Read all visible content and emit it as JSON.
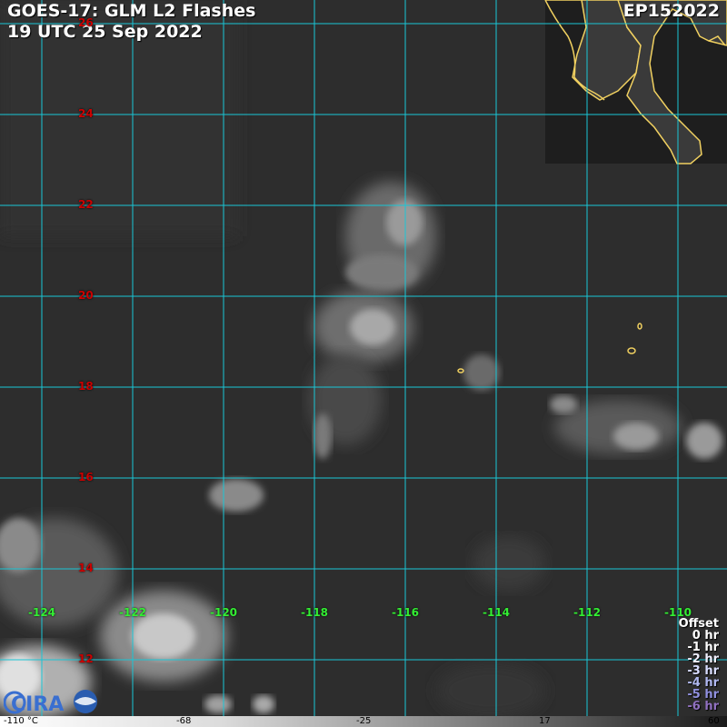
{
  "header": {
    "title": "GOES-17: GLM L2 Flashes",
    "datetime": "19 UTC 25 Sep 2022",
    "storm_id": "EP152022"
  },
  "latitude_labels": [
    "26",
    "24",
    "22",
    "20",
    "18",
    "16",
    "14",
    "12"
  ],
  "longitude_labels": [
    "-124",
    "-122",
    "-120",
    "-118",
    "-116",
    "-114",
    "-112",
    "-110"
  ],
  "offset_legend": {
    "title": "Offset",
    "items": [
      {
        "label": "0 hr",
        "color": "#ffffff"
      },
      {
        "label": "-1 hr",
        "color": "#ffffff"
      },
      {
        "label": "-2 hr",
        "color": "#f0f0ff"
      },
      {
        "label": "-3 hr",
        "color": "#d8dcff"
      },
      {
        "label": "-4 hr",
        "color": "#b0b8f0"
      },
      {
        "label": "-5 hr",
        "color": "#9090e0"
      },
      {
        "label": "-6 hr",
        "color": "#9070c0"
      }
    ]
  },
  "colorbar": {
    "labels": [
      "-110 °C",
      "-68",
      "-25",
      "17",
      "60"
    ]
  },
  "colors": {
    "grid": "#19c6d6",
    "coastline": "#f0d060",
    "lat_label": "#cc0000",
    "lon_label": "#33ee33"
  },
  "logo": {
    "text": "CIRA"
  }
}
